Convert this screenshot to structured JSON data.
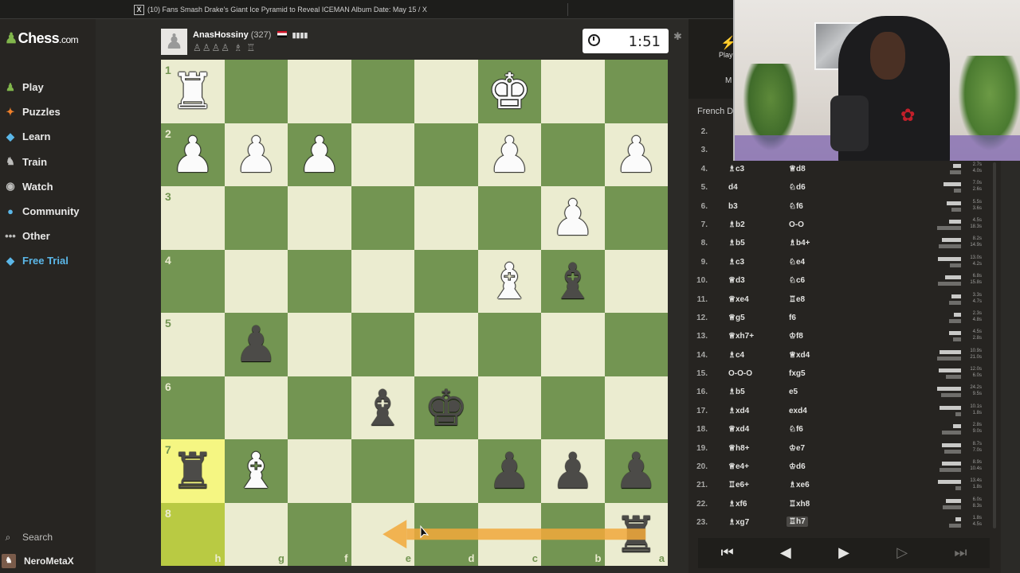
{
  "window": {
    "tab_title": "(10) Fans Smash Drake's Giant Ice Pyramid to Reveal ICEMAN Album Date: May 15 / X"
  },
  "sidebar": {
    "logo_text": "Chess",
    "logo_suffix": ".com",
    "items": [
      {
        "label": "Play",
        "icon": "play-icon",
        "color": "#81b64c"
      },
      {
        "label": "Puzzles",
        "icon": "puzzle-icon",
        "color": "#f0802a"
      },
      {
        "label": "Learn",
        "icon": "learn-icon",
        "color": "#5bb7e8"
      },
      {
        "label": "Train",
        "icon": "train-icon",
        "color": "#bdbdbb"
      },
      {
        "label": "Watch",
        "icon": "watch-icon",
        "color": "#bdbdbb"
      },
      {
        "label": "Community",
        "icon": "community-icon",
        "color": "#5bb7e8"
      },
      {
        "label": "Other",
        "icon": "more-icon",
        "color": "#bdbdbb"
      },
      {
        "label": "Free Trial",
        "icon": "diamond-icon",
        "color": "#5bb7e8"
      }
    ],
    "search_label": "Search",
    "user_label": "NeroMetaX"
  },
  "player": {
    "name": "AnasHossiny",
    "rating": "(327)",
    "signal": "▮▮▮▮",
    "captured": "♙♙♙♙ ♗ ♖"
  },
  "clock": {
    "time": "1:51"
  },
  "board": {
    "orientation": "black",
    "files": [
      "h",
      "g",
      "f",
      "e",
      "d",
      "c",
      "b",
      "a"
    ],
    "ranks": [
      "1",
      "2",
      "3",
      "4",
      "5",
      "6",
      "7",
      "8"
    ],
    "light_color": "#ebecd0",
    "dark_color": "#739552",
    "highlight_light": "#f5f682",
    "highlight_dark": "#b9ca43",
    "highlights": [
      "h7",
      "h8"
    ],
    "arrow": {
      "from": "a8",
      "to": "e8",
      "color": "#f2a93b"
    },
    "pieces": [
      {
        "square": "h1",
        "type": "rook",
        "color": "white",
        "glyph": "♜"
      },
      {
        "square": "c1",
        "type": "king",
        "color": "white",
        "glyph": "♚"
      },
      {
        "square": "h2",
        "type": "pawn",
        "color": "white",
        "glyph": "♟"
      },
      {
        "square": "g2",
        "type": "pawn",
        "color": "white",
        "glyph": "♟"
      },
      {
        "square": "f2",
        "type": "pawn",
        "color": "white",
        "glyph": "♟"
      },
      {
        "square": "c2",
        "type": "pawn",
        "color": "white",
        "glyph": "♟"
      },
      {
        "square": "a2",
        "type": "pawn",
        "color": "white",
        "glyph": "♟"
      },
      {
        "square": "b3",
        "type": "pawn",
        "color": "white",
        "glyph": "♟"
      },
      {
        "square": "c4",
        "type": "bishop",
        "color": "white",
        "glyph": "♝"
      },
      {
        "square": "b4",
        "type": "bishop",
        "color": "black",
        "glyph": "♝"
      },
      {
        "square": "g5",
        "type": "pawn",
        "color": "black",
        "glyph": "♟"
      },
      {
        "square": "e6",
        "type": "bishop",
        "color": "black",
        "glyph": "♝"
      },
      {
        "square": "d6",
        "type": "king",
        "color": "black",
        "glyph": "♚"
      },
      {
        "square": "h7",
        "type": "rook",
        "color": "black",
        "glyph": "♜"
      },
      {
        "square": "g7",
        "type": "bishop",
        "color": "white",
        "glyph": "♝"
      },
      {
        "square": "c7",
        "type": "pawn",
        "color": "black",
        "glyph": "♟"
      },
      {
        "square": "b7",
        "type": "pawn",
        "color": "black",
        "glyph": "♟"
      },
      {
        "square": "a7",
        "type": "pawn",
        "color": "black",
        "glyph": "♟"
      },
      {
        "square": "a8",
        "type": "rook",
        "color": "black",
        "glyph": "♜"
      }
    ]
  },
  "panel": {
    "play_label": "Play",
    "m_label": "M",
    "opening": "French De",
    "moves": [
      {
        "n": "2.",
        "w": "",
        "b": ""
      },
      {
        "n": "3.",
        "w": "",
        "b": ""
      },
      {
        "n": "4.",
        "w": "♗c3",
        "b": "♕d8",
        "tw": "2.7s",
        "tb": "4.0s",
        "fw": 10,
        "fb": 14
      },
      {
        "n": "5.",
        "w": "d4",
        "b": "♘d6",
        "tw": "7.0s",
        "tb": "2.6s",
        "fw": 22,
        "fb": 9
      },
      {
        "n": "6.",
        "w": "b3",
        "b": "♘f6",
        "tw": "5.5s",
        "tb": "3.6s",
        "fw": 18,
        "fb": 12
      },
      {
        "n": "7.",
        "w": "♗b2",
        "b": "O-O",
        "tw": "4.5s",
        "tb": "18.3s",
        "fw": 15,
        "fb": 30
      },
      {
        "n": "8.",
        "w": "♗b5",
        "b": "♗b4+",
        "tw": "8.2s",
        "tb": "14.9s",
        "fw": 24,
        "fb": 28
      },
      {
        "n": "9.",
        "w": "♗c3",
        "b": "♘e4",
        "tw": "13.0s",
        "tb": "4.2s",
        "fw": 29,
        "fb": 14
      },
      {
        "n": "10.",
        "w": "♕d3",
        "b": "♘c6",
        "tw": "6.8s",
        "tb": "15.8s",
        "fw": 20,
        "fb": 29
      },
      {
        "n": "11.",
        "w": "♕xe4",
        "b": "♖e8",
        "tw": "3.3s",
        "tb": "4.7s",
        "fw": 12,
        "fb": 15
      },
      {
        "n": "12.",
        "w": "♕g5",
        "b": "f6",
        "tw": "2.3s",
        "tb": "4.8s",
        "fw": 9,
        "fb": 15
      },
      {
        "n": "13.",
        "w": "♕xh7+",
        "b": "♔f8",
        "tw": "4.5s",
        "tb": "2.8s",
        "fw": 15,
        "fb": 10
      },
      {
        "n": "14.",
        "w": "♗c4",
        "b": "♕xd4",
        "tw": "10.9s",
        "tb": "21.0s",
        "fw": 27,
        "fb": 30
      },
      {
        "n": "15.",
        "w": "O-O-O",
        "b": "fxg5",
        "tw": "12.0s",
        "tb": "6.0s",
        "fw": 28,
        "fb": 19
      },
      {
        "n": "16.",
        "w": "♗b5",
        "b": "e5",
        "tw": "24.2s",
        "tb": "9.5s",
        "fw": 30,
        "fb": 25
      },
      {
        "n": "17.",
        "w": "♗xd4",
        "b": "exd4",
        "tw": "10.1s",
        "tb": "1.8s",
        "fw": 27,
        "fb": 7
      },
      {
        "n": "18.",
        "w": "♕xd4",
        "b": "♘f6",
        "tw": "2.8s",
        "tb": "9.0s",
        "fw": 10,
        "fb": 24
      },
      {
        "n": "19.",
        "w": "♕h8+",
        "b": "♔e7",
        "tw": "8.7s",
        "tb": "7.0s",
        "fw": 24,
        "fb": 21
      },
      {
        "n": "20.",
        "w": "♕e4+",
        "b": "♔d6",
        "tw": "8.9s",
        "tb": "10.4s",
        "fw": 24,
        "fb": 27
      },
      {
        "n": "21.",
        "w": "♖e6+",
        "b": "♗xe6",
        "tw": "13.4s",
        "tb": "1.8s",
        "fw": 29,
        "fb": 7
      },
      {
        "n": "22.",
        "w": "♗xf6",
        "b": "♖xh8",
        "tw": "6.0s",
        "tb": "8.3s",
        "fw": 19,
        "fb": 23
      },
      {
        "n": "23.",
        "w": "♗xg7",
        "b": "♖h7",
        "tw": "1.8s",
        "tb": "4.5s",
        "fw": 7,
        "fb": 15,
        "hl": true
      }
    ],
    "nav": [
      "⏮",
      "◀",
      "▶",
      "▷",
      "⏭"
    ]
  }
}
